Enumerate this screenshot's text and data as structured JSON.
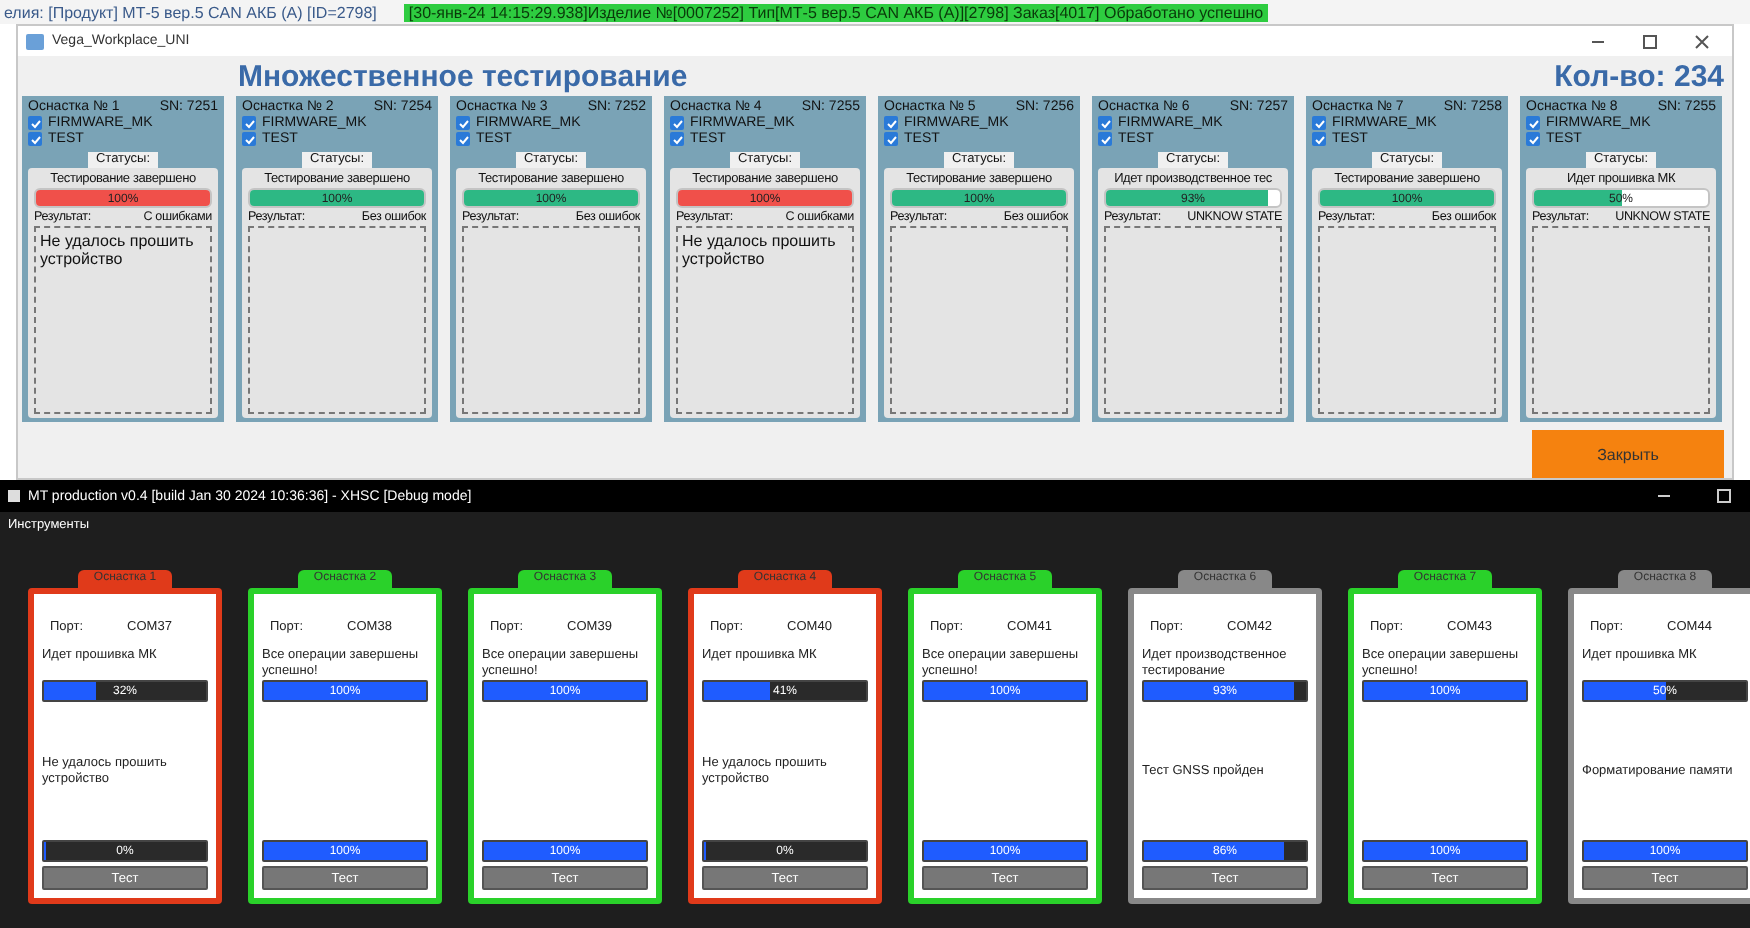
{
  "background_strip": {
    "left_text": "елия:   [Продукт] МТ-5 вер.5 CAN АКБ (А) [ID=2798]",
    "log_text": "[30-янв-24 14:15:29.938]Изделие №[0007252] Тип[МТ-5 вер.5 CAN АКБ (А)][2798] Заказ[4017]  Обработано успешно"
  },
  "top_window": {
    "title": "Vega_Workplace_UNI",
    "heading": "Множественное тестирование",
    "count": "Кол-во: 234",
    "fixtures": [
      {
        "name": "Оснастка № 1",
        "sn": "SN: 7251",
        "checks": [
          {
            "label": "FIRMWARE_MK",
            "checked": true
          },
          {
            "label": "TEST",
            "checked": true
          }
        ],
        "status_tab": "Статусы:",
        "status": "Тестирование завершено",
        "color": "#f0504a",
        "level": 1,
        "progress_text": "100%",
        "result_label": "Результат:",
        "result": "С ошибками",
        "log": "Не удалось прошить устройство"
      },
      {
        "name": "Оснастка № 2",
        "sn": "SN: 7254",
        "checks": [
          {
            "label": "FIRMWARE_MK",
            "checked": true
          },
          {
            "label": "TEST",
            "checked": true
          }
        ],
        "status_tab": "Статусы:",
        "status": "Тестирование завершено",
        "color": "#2db884",
        "level": 1,
        "progress_text": "100%",
        "result_label": "Результат:",
        "result": "Без ошибок"
      },
      {
        "name": "Оснастка № 3",
        "sn": "SN: 7252",
        "checks": [
          {
            "label": "FIRMWARE_MK",
            "checked": true
          },
          {
            "label": "TEST",
            "checked": true
          }
        ],
        "status_tab": "Статусы:",
        "status": "Тестирование завершено",
        "color": "#2db884",
        "level": 1,
        "progress_text": "100%",
        "result_label": "Результат:",
        "result": "Без ошибок"
      },
      {
        "name": "Оснастка № 4",
        "sn": "SN: 7255",
        "checks": [
          {
            "label": "FIRMWARE_MK",
            "checked": true
          },
          {
            "label": "TEST",
            "checked": true
          }
        ],
        "status_tab": "Статусы:",
        "status": "Тестирование завершено",
        "color": "#f0504a",
        "level": 1,
        "progress_text": "100%",
        "result_label": "Результат:",
        "result": "С ошибками",
        "log": "Не удалось прошить устройство"
      },
      {
        "name": "Оснастка № 5",
        "sn": "SN: 7256",
        "checks": [
          {
            "label": "FIRMWARE_MK",
            "checked": true
          },
          {
            "label": "TEST",
            "checked": true
          }
        ],
        "status_tab": "Статусы:",
        "status": "Тестирование завершено",
        "color": "#2db884",
        "level": 1,
        "progress_text": "100%",
        "result_label": "Результат:",
        "result": "Без ошибок"
      },
      {
        "name": "Оснастка № 6",
        "sn": "SN: 7257",
        "checks": [
          {
            "label": "FIRMWARE_MK",
            "checked": true
          },
          {
            "label": "TEST",
            "checked": true
          }
        ],
        "status_tab": "Статусы:",
        "status": "Идет производственное тес",
        "color": "#2db884",
        "level": 0.93,
        "progress_text": "93%",
        "result_label": "Результат:",
        "result": "UNKNOW STATE"
      },
      {
        "name": "Оснастка № 7",
        "sn": "SN: 7258",
        "checks": [
          {
            "label": "FIRMWARE_MK",
            "checked": true
          },
          {
            "label": "TEST",
            "checked": true
          }
        ],
        "status_tab": "Статусы:",
        "status": "Тестирование завершено",
        "color": "#2db884",
        "level": 1,
        "progress_text": "100%",
        "result_label": "Результат:",
        "result": "Без ошибок"
      },
      {
        "name": "Оснастка № 8",
        "sn": "SN: 7255",
        "checks": [
          {
            "label": "FIRMWARE_MK",
            "checked": true
          },
          {
            "label": "TEST",
            "checked": true
          }
        ],
        "status_tab": "Статусы:",
        "status": "Идет прошивка МК",
        "color": "#2db884",
        "level": 0.5,
        "progress_text": "50%",
        "result_label": "Результат:",
        "result": "UNKNOW STATE"
      }
    ],
    "close_button": "Закрыть"
  },
  "bottom_window": {
    "title": "MT production v0.4 [build Jan 30 2024 10:36:36] - XHSC [Debug mode]",
    "menu": [
      "Инструменты"
    ],
    "fixtures": [
      {
        "tab": "Оснастка 1",
        "color": "#e03a1a",
        "port_label": "Порт:",
        "port": "COM37",
        "status": "Идет прошивка МК",
        "progress": {
          "level": 0.32,
          "text": "32%"
        },
        "message": "Не удалось прошить устройство",
        "total": {
          "level": 0,
          "text": "0%"
        },
        "button": "Тест"
      },
      {
        "tab": "Оснастка 2",
        "color": "#2ad12a",
        "port_label": "Порт:",
        "port": "COM38",
        "status": "Все операции завершены успешно!",
        "progress": {
          "level": 1,
          "text": "100%"
        },
        "total": {
          "level": 1,
          "text": "100%"
        },
        "button": "Тест"
      },
      {
        "tab": "Оснастка 3",
        "color": "#2ad12a",
        "port_label": "Порт:",
        "port": "COM39",
        "status": "Все операции завершены успешно!",
        "progress": {
          "level": 1,
          "text": "100%"
        },
        "total": {
          "level": 1,
          "text": "100%"
        },
        "button": "Тест"
      },
      {
        "tab": "Оснастка 4",
        "color": "#e03a1a",
        "port_label": "Порт:",
        "port": "COM40",
        "status": "Идет прошивка МК",
        "progress": {
          "level": 0.41,
          "text": "41%"
        },
        "message": "Не удалось прошить устройство",
        "total": {
          "level": 0,
          "text": "0%"
        },
        "button": "Тест"
      },
      {
        "tab": "Оснастка 5",
        "color": "#2ad12a",
        "port_label": "Порт:",
        "port": "COM41",
        "status": "Все операции завершены успешно!",
        "progress": {
          "level": 1,
          "text": "100%"
        },
        "total": {
          "level": 1,
          "text": "100%"
        },
        "button": "Тест"
      },
      {
        "tab": "Оснастка 6",
        "color": "#888888",
        "port_label": "Порт:",
        "port": "COM42",
        "status": "Идет производственное тестирование",
        "progress": {
          "level": 0.93,
          "text": "93%"
        },
        "message": "Тест GNSS пройден",
        "total": {
          "level": 0.86,
          "text": "86%"
        },
        "button": "Тест"
      },
      {
        "tab": "Оснастка 7",
        "color": "#2ad12a",
        "port_label": "Порт:",
        "port": "COM43",
        "status": "Все операции завершены успешно!",
        "progress": {
          "level": 1,
          "text": "100%"
        },
        "total": {
          "level": 1,
          "text": "100%"
        },
        "button": "Тест"
      },
      {
        "tab": "Оснастка 8",
        "color": "#888888",
        "port_label": "Порт:",
        "port": "COM44",
        "status": "Идет прошивка МК",
        "progress": {
          "level": 0.5,
          "text": "50%"
        },
        "message": "Форматирование памяти",
        "total": {
          "level": 1,
          "text": "100%"
        },
        "button": "Тест"
      }
    ]
  }
}
